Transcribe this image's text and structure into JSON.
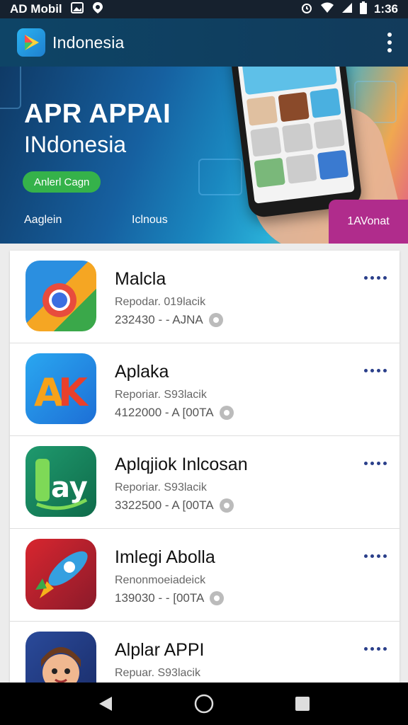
{
  "status_bar": {
    "left_text": "AD Mobil",
    "time": "1:36",
    "icons": [
      "image-icon",
      "location-icon",
      "alarm-icon",
      "wifi-icon",
      "signal-icon",
      "battery-icon"
    ]
  },
  "app_bar": {
    "title": "Indonesia",
    "logo_icon": "play-logo-icon",
    "overflow_icon": "more-vertical-icon"
  },
  "hero": {
    "title": "APR APPAI",
    "subtitle": "INdonesia",
    "button_label": "Anlerl Cagn",
    "tabs": [
      "Aaglein",
      "Iclnous",
      "1AVonat"
    ],
    "accent_colors": {
      "button": "#35b24a",
      "tab_active": "#b02c8c"
    }
  },
  "list": {
    "items": [
      {
        "title": "Malcla",
        "subtitle": "Repodar. 019lacik",
        "meta": "232430 - -  AJNA",
        "icon": "chrome-style-app-icon"
      },
      {
        "title": "Aplaka",
        "subtitle": "Reporiar. S93lacik",
        "meta": "4122000 - A [00TA",
        "icon": "apk-app-icon"
      },
      {
        "title": "Aplqjiok Inlcosan",
        "subtitle": "Reporiar. S93lacik",
        "meta": "3322500 - A [00TA",
        "icon": "green-app-icon"
      },
      {
        "title": "Imlegi Abolla",
        "subtitle": "Renonmoeiadeick",
        "meta": "139030 - -  [00TA",
        "icon": "rocket-app-icon"
      },
      {
        "title": "Alplar APPI",
        "subtitle": "Repuar. S93lacik",
        "meta": "",
        "icon": "character-app-icon"
      }
    ],
    "more_icon": "more-horizontal-icon"
  },
  "nav_bar": {
    "icons": [
      "back-icon",
      "home-icon",
      "recents-icon"
    ]
  }
}
